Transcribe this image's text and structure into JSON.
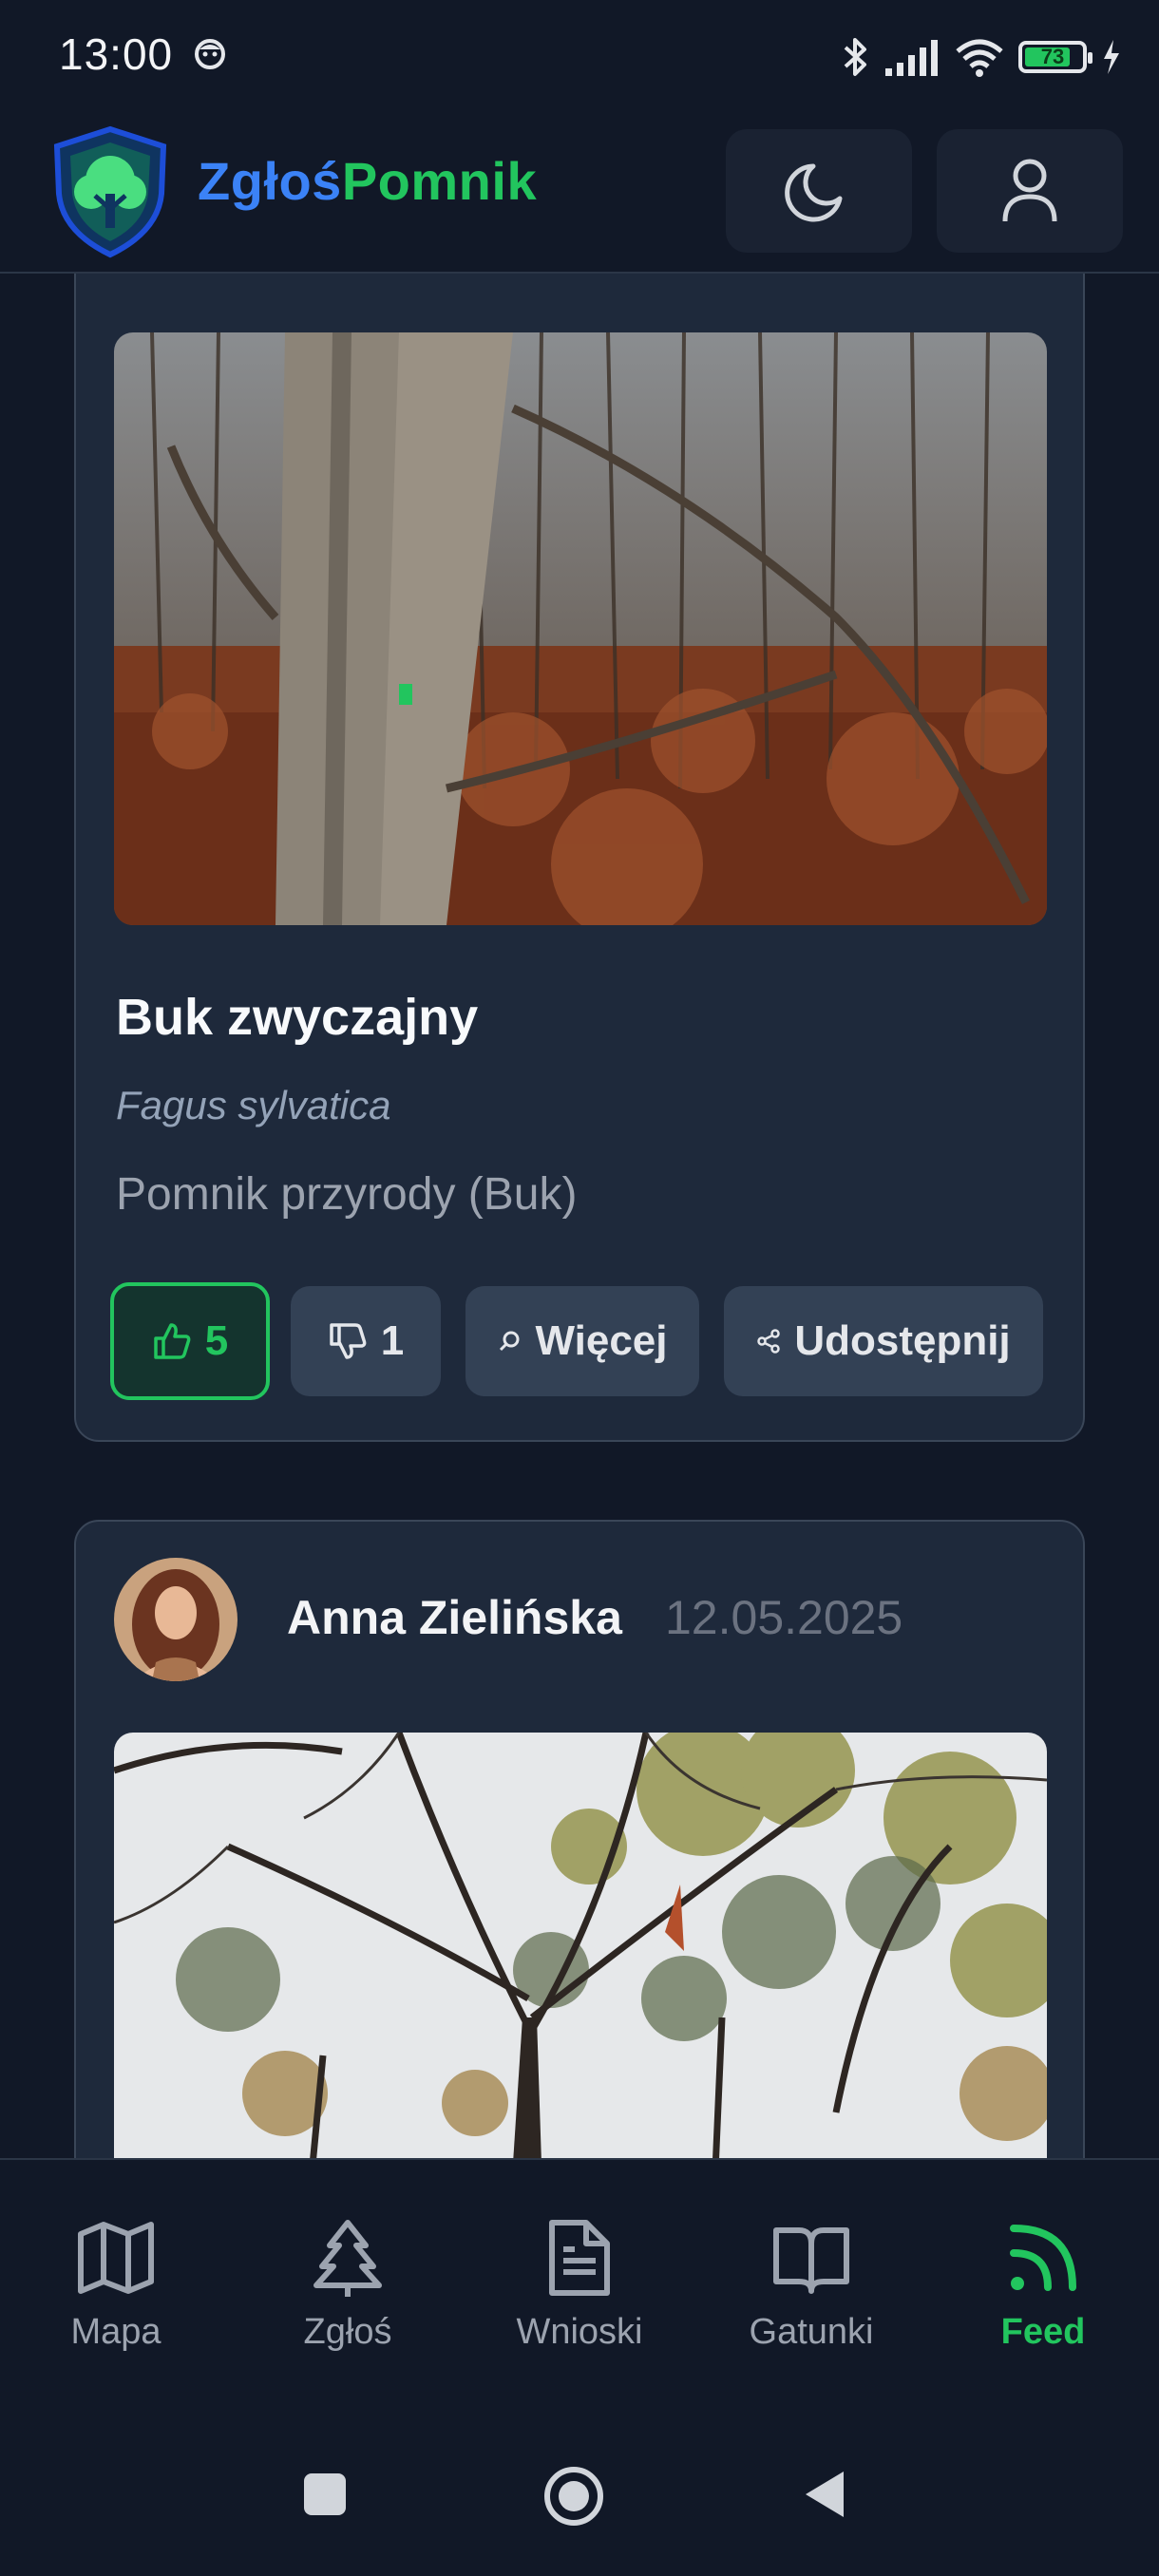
{
  "status_bar": {
    "time": "13:00",
    "battery_level": "73",
    "icons": [
      "face-icon",
      "bluetooth-icon",
      "signal-icon",
      "wifi-icon",
      "battery-icon",
      "charging-icon"
    ]
  },
  "header": {
    "brand_part1": "Zgłoś",
    "brand_part2": "Pomnik",
    "theme_button": "moon-icon",
    "profile_button": "user-icon",
    "colors": {
      "brand_blue": "#3b82f6",
      "brand_green": "#22c55e"
    }
  },
  "posts": [
    {
      "title": "Buk zwyczajny",
      "latin_name": "Fagus sylvatica",
      "description": "Pomnik przyrody (Buk)",
      "likes": "5",
      "dislikes": "1",
      "more_label": "Więcej",
      "share_label": "Udostępnij"
    },
    {
      "author": "Anna Zielińska",
      "date": "12.05.2025"
    }
  ],
  "bottom_nav": {
    "items": [
      {
        "label": "Mapa",
        "icon": "map-icon"
      },
      {
        "label": "Zgłoś",
        "icon": "tree-icon"
      },
      {
        "label": "Wnioski",
        "icon": "document-icon"
      },
      {
        "label": "Gatunki",
        "icon": "book-icon"
      },
      {
        "label": "Feed",
        "icon": "rss-icon",
        "active": true
      }
    ],
    "active_color": "#22c55e"
  },
  "system_nav": [
    "recents-button",
    "home-button",
    "back-button"
  ]
}
